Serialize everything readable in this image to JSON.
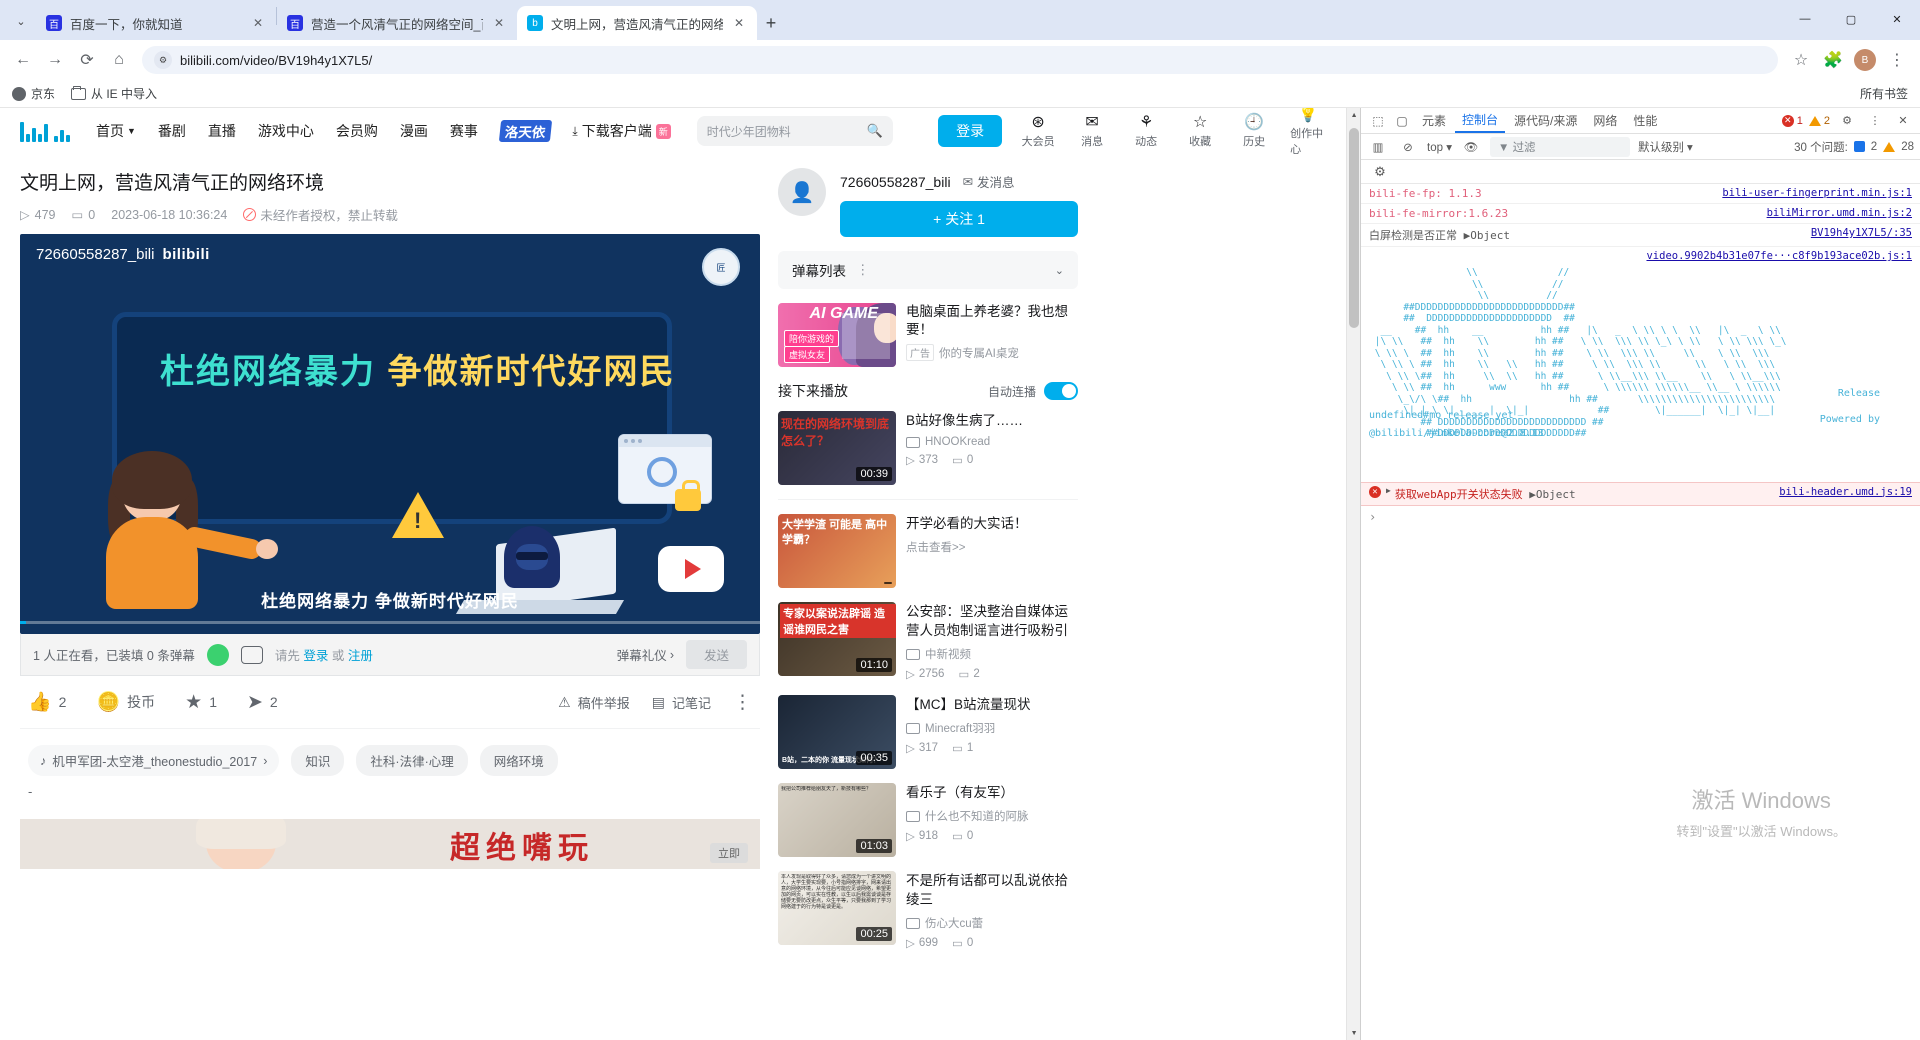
{
  "browser": {
    "tabs": [
      {
        "title": "百度一下，你就知道",
        "favicon": "baidu-icon",
        "active": false
      },
      {
        "title": "营造一个风清气正的网络空间_百",
        "favicon": "baidu-icon",
        "active": false
      },
      {
        "title": "文明上网，营造风清气正的网络",
        "favicon": "bilibili-icon",
        "active": true
      }
    ],
    "new_tab_label": "+",
    "tab_close_label": "✕",
    "tab_list_label": "⌄",
    "window_controls": {
      "minimize": "—",
      "maximize": "▢",
      "close": "✕"
    },
    "nav": {
      "back": "←",
      "forward": "→",
      "reload": "⟳",
      "home": "⌂"
    },
    "omnibox": {
      "url": "bilibili.com/video/BV19h4y1X7L5/",
      "site_settings_icon": "tune-icon"
    },
    "toolbar_right": {
      "bookmark_star": "☆",
      "extensions": "puzzle-icon",
      "profile": "B",
      "menu": "⋮"
    },
    "bookmarks": {
      "items": [
        {
          "label": "京东",
          "icon": "globe-icon"
        },
        {
          "label": "从 IE 中导入",
          "icon": "folder-icon"
        }
      ],
      "all_bookmarks": "所有书签"
    }
  },
  "bilibili": {
    "nav": [
      {
        "label": "首页",
        "has_chevron": true
      },
      {
        "label": "番剧",
        "has_chevron": false
      },
      {
        "label": "直播",
        "has_chevron": false
      },
      {
        "label": "游戏中心",
        "has_chevron": false
      },
      {
        "label": "会员购",
        "has_chevron": false
      },
      {
        "label": "漫画",
        "has_chevron": false
      },
      {
        "label": "赛事",
        "has_chevron": false
      }
    ],
    "nav_highlight": "洛天依",
    "download_client": "下载客户端",
    "download_badge": "新",
    "search": {
      "placeholder": "时代少年团物料",
      "icon": "search-icon"
    },
    "login_button": "登录",
    "user_icons": [
      {
        "label": "大会员",
        "icon": "vip-icon"
      },
      {
        "label": "消息",
        "icon": "mail-icon"
      },
      {
        "label": "动态",
        "icon": "dynamic-icon"
      },
      {
        "label": "收藏",
        "icon": "star-icon"
      },
      {
        "label": "历史",
        "icon": "clock-icon"
      },
      {
        "label": "创作中心",
        "icon": "bulb-icon"
      }
    ]
  },
  "video": {
    "title": "文明上网，营造风清气正的网络环境",
    "views": "479",
    "danmaku": "0",
    "date": "2023-06-18 10:36:24",
    "copyright": "未经作者授权，禁止转载",
    "player": {
      "uploader_watermark": "72660558287_bili",
      "brand": "bilibili",
      "headline_part1": "杜绝网络暴力",
      "headline_part2": "争做新时代好网民",
      "subtitle": "杜绝网络暴力  争做新时代好网民",
      "seal_text": "匠"
    },
    "danmaku_bar": {
      "status": "1 人正在看，已装填 0 条弹幕",
      "input_prefix": "请先",
      "login_link": "登录",
      "input_mid": "或",
      "register_link": "注册",
      "gift": "弹幕礼仪",
      "send": "发送"
    },
    "actions": [
      {
        "label": "2",
        "icon": "thumbs-up-icon"
      },
      {
        "label": "投币",
        "icon": "coin-icon"
      },
      {
        "label": "1",
        "icon": "star-icon"
      },
      {
        "label": "2",
        "icon": "share-icon"
      }
    ],
    "actions_right": [
      {
        "label": "稿件举报",
        "icon": "warning-icon"
      },
      {
        "label": "记笔记",
        "icon": "note-icon"
      },
      {
        "label": "",
        "icon": "more-vertical-icon"
      }
    ],
    "music_tag": "机甲军团-太空港_theonestudio_2017",
    "tags": [
      "知识",
      "社科·法律·心理",
      "网络环境"
    ],
    "dash": "-"
  },
  "banner": {
    "text": "超绝嘴玩",
    "button": "立即"
  },
  "uploader": {
    "name": "72660558287_bili",
    "message_label": "发消息",
    "follow_label": "+ 关注 1"
  },
  "sidebar": {
    "danmaku_list_title": "弹幕列表",
    "ad": {
      "title": "电脑桌面上养老婆？我也想要！",
      "tag": "广告",
      "subtitle": "你的专属AI桌宠",
      "thumb_label1": "陪你游戏的",
      "thumb_label2": "虚拟女友",
      "thumb_ai": "AI GAME"
    },
    "next_play_label": "接下来播放",
    "autoplay_label": "自动连播",
    "recommendations": [
      {
        "title": "B站好像生病了……",
        "uploader": "HNOOKread",
        "views": "373",
        "danmaku": "0",
        "duration": "00:39",
        "thumb_caption": "现在的网络环境到底怎么了？",
        "thumb_style": "th-a"
      },
      {
        "title": "开学必看的大实话！",
        "uploader": "点击查看>>",
        "views": "",
        "danmaku": "",
        "duration": "",
        "thumb_caption": "大学学渣 可能是 高中学霸？",
        "thumb_style": "th-b"
      },
      {
        "title": "公安部：坚决整治自媒体运营人员炮制谣言进行吸粉引流…",
        "uploader": "中新视频",
        "views": "2756",
        "danmaku": "2",
        "duration": "01:10",
        "thumb_caption": "专家以案说法辟谣 造谣谁网民之害",
        "thumb_style": "th-c"
      },
      {
        "title": "【MC】B站流量现状",
        "uploader": "Minecraft羽羽",
        "views": "317",
        "danmaku": "1",
        "duration": "00:35",
        "thumb_caption": "B站，二本的你 流量现状如何？",
        "thumb_style": "th-d"
      },
      {
        "title": "看乐子（有友军）",
        "uploader": "什么也不知道的阿脉",
        "views": "918",
        "danmaku": "0",
        "duration": "01:03",
        "thumb_caption": "我把公司推荐给朋友天了，新技有哪些？",
        "thumb_style": "th-e"
      },
      {
        "title": "不是所有话都可以乱说依拾绫三",
        "uploader": "伤心大cu蕾",
        "views": "699",
        "danmaku": "0",
        "duration": "00:25",
        "thumb_caption": "本人发现是取得好了众多，请您成为一个讲文明的人，大学生要实现要，小号指网络排字，网来请出意的网络环境，从今往后可能应见谈网络，希望更加的网页，可以实在性教，以生以后我需谈谈是存储要无要防改更点，众生平等，只要我那到了学习网络建于的行为特是谈更是。",
        "thumb_style": "th-f"
      }
    ]
  },
  "devtools": {
    "tabs": [
      {
        "label": "元素",
        "active": false
      },
      {
        "label": "控制台",
        "active": true
      },
      {
        "label": "源代码/来源",
        "active": false
      },
      {
        "label": "网络",
        "active": false
      },
      {
        "label": "性能",
        "active": false
      }
    ],
    "inspect_icon": "inspect-icon",
    "device_icon": "device-toolbar-icon",
    "errors_count": "1",
    "warnings_count": "2",
    "settings_icon": "gear-icon",
    "close_icon": "close-icon",
    "subbar": {
      "clear_icon": "no-entry-icon",
      "context": "top",
      "eye_icon": "eye-icon",
      "filter_placeholder": "过滤",
      "level": "默认级别",
      "issues": "30 个问题:",
      "issue_blue": "2",
      "issue_warn": "28"
    },
    "console_lines": [
      {
        "text": "bili-fe-fp: 1.1.3",
        "source": "bili-user-fingerprint.min.js:1",
        "style": "pink"
      },
      {
        "text": "bili-fe-mirror:1.6.23",
        "source": "biliMirror.umd.min.js:2",
        "style": "pink"
      },
      {
        "text": "白屏检测是否正常 ▶Object",
        "source": "BV19h4y1X7L5/:35",
        "style": "plain"
      },
      {
        "text": "",
        "source": "video.9902b4b31e07fe···c8f9b193ace02b.js:1",
        "style": "plain"
      }
    ],
    "ascii_art": "                 \\\\              //\n                  \\\\            //\n                   \\\\          //\n      ##DDDDDDDDDDDDDDDDDDDDDDDDDD##\n      ##  DDDDDDDDDDDDDDDDDDDDDD  ##\n  __    ##  hh    __          hh ##   |\\   _  \\ \\\\ \\ \\  \\\\   |\\  _  \\ \\\\\n |\\ \\\\   ##  hh    \\\\        hh ##   \\ \\\\  \\\\\\ \\\\ \\_\\ \\ \\\\   \\ \\\\ \\\\\\ \\_\\\n \\ \\\\ \\  ##  hh    \\\\        hh ##    \\ \\\\  \\\\\\ \\\\     \\\\    \\ \\\\  \\\\\\\n  \\ \\\\ \\ ##  hh    \\\\   \\\\   hh ##     \\ \\\\  \\\\\\ \\\\      \\\\   \\ \\\\  \\\\\\\n   \\ \\\\ \\##  hh     \\\\  \\\\   hh ##      \\ \\\\__\\\\\\ \\\\__    \\\\   \\ \\\\__\\\\\\\n    \\ \\\\ ##  hh      www      hh ##      \\ \\\\\\\\\\\\ \\\\\\\\\\\\__ \\\\__ \\ \\\\\\\\\\\\\n     \\_\\/\\ \\##  hh                 hh ##       \\\\\\\\\\\\\\\\\\\\\\\\\\\\\\\\\\\\\\\\\\\\\\\\\n      \\|_| \\ \\|______|  \\|_|            ##        \\|______|  \\|_| \\|__|\n         ## DDDDDDDDDDDDDDDDDDDDDDDDDD ##\n          ##DDDDDDDDDDDDDDDDDDDDDDDD##",
    "release_label": "Release",
    "powered_label": "Powered by",
    "undefined_line": "undefined#mo release yet",
    "core_line": "@bilibili/jinkela-core@2.8.13",
    "error_line": {
      "text": "获取webApp开关状态失败",
      "object": "▶Object",
      "source": "bili-header.umd.js:19"
    },
    "prompt": "›"
  },
  "watermark": {
    "line1": "激活 Windows",
    "line2": "转到\"设置\"以激活 Windows。"
  }
}
